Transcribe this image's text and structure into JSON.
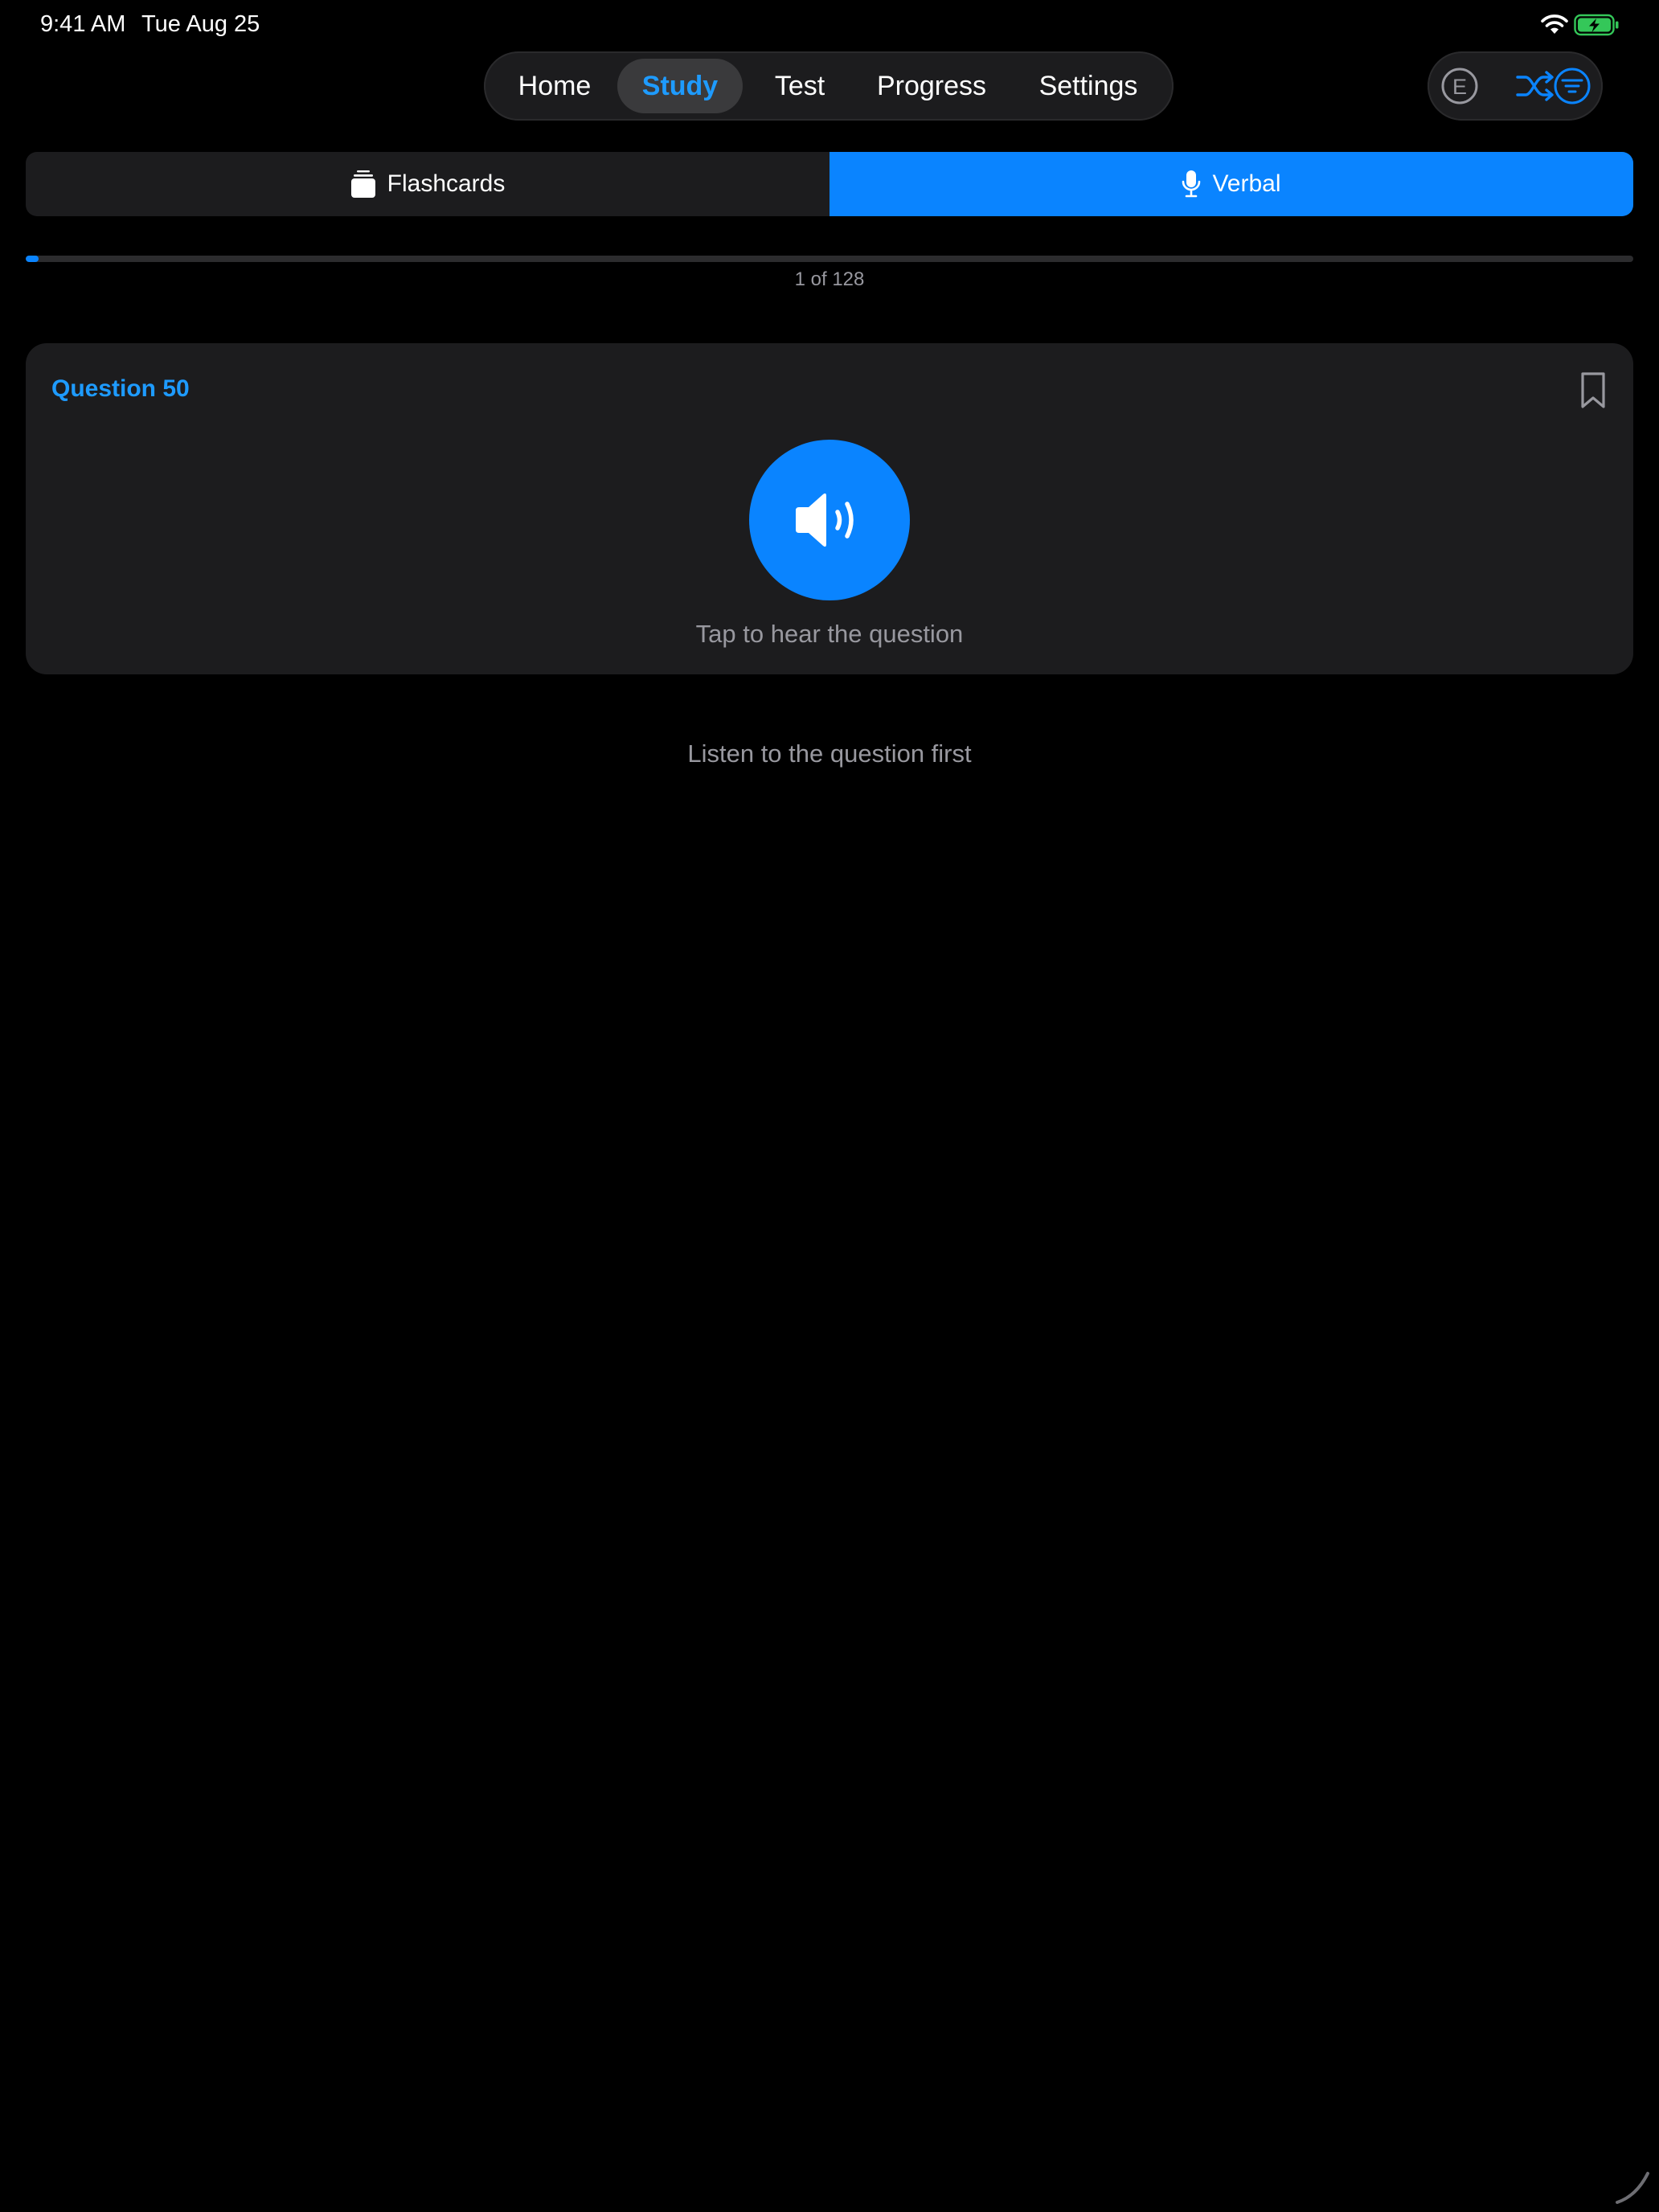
{
  "status_bar": {
    "time": "9:41 AM",
    "date": "Tue Aug 25",
    "icons": [
      "wifi-icon",
      "battery-charging-icon"
    ]
  },
  "nav": {
    "tabs": [
      {
        "label": "Home",
        "active": false
      },
      {
        "label": "Study",
        "active": true
      },
      {
        "label": "Test",
        "active": false
      },
      {
        "label": "Progress",
        "active": false
      },
      {
        "label": "Settings",
        "active": false
      }
    ]
  },
  "toolbar": {
    "buttons": [
      {
        "icon": "e-circle-icon",
        "letter": "E"
      },
      {
        "icon": "shuffle-icon"
      },
      {
        "icon": "filter-icon"
      }
    ]
  },
  "mode_selector": {
    "options": [
      {
        "label": "Flashcards",
        "icon": "cards-stack-icon",
        "active": false
      },
      {
        "label": "Verbal",
        "icon": "microphone-icon",
        "active": true
      }
    ]
  },
  "progress": {
    "current": 1,
    "total": 128,
    "text": "1 of 128"
  },
  "question_card": {
    "title": "Question 50",
    "play_caption": "Tap to hear the question",
    "bookmark_icon": "bookmark-icon",
    "play_icon": "speaker-icon"
  },
  "hint": "Listen to the question first",
  "colors": {
    "accent": "#0a84ff",
    "accent_text": "#1e9bff",
    "background": "#000000",
    "surface": "#1c1c1e",
    "secondary_text": "#98989f",
    "battery_green": "#34c759"
  }
}
